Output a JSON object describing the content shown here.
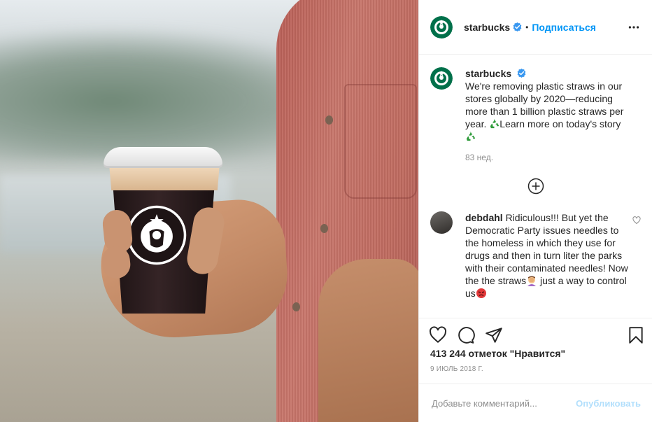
{
  "post": {
    "author": "starbucks",
    "follow_label": "Подписаться",
    "separator": "•"
  },
  "caption": {
    "username": "starbucks",
    "text_before": "We're removing plastic straws in our stores globally by 2020—reducing more than 1 billion plastic straws per year. ",
    "text_after": "Learn more on today's story",
    "time": "83 нед."
  },
  "comment": {
    "username": "debdahl",
    "text_before": "Ridiculous!!! But yet the Democratic Party issues needles to the homeless in which they use for drugs and then in turn liter the parks with their contaminated needles! Now the the straws",
    "text_after": " just a way to control us"
  },
  "likes": "413 244 отметок \"Нравится\"",
  "date": "9 ИЮЛЬ 2018 Г.",
  "add_comment": {
    "placeholder": "Добавьте комментарий...",
    "publish_label": "Опубликовать"
  },
  "icons": {
    "verified": "verified-badge-icon",
    "more": "more-options-icon",
    "load_more": "plus-circle-icon",
    "like": "heart-icon",
    "comment": "comment-bubble-icon",
    "share": "paper-plane-icon",
    "save": "bookmark-icon",
    "recycle": "recycle-emoji-icon",
    "facepalm": "facepalm-emoji-icon",
    "angry": "angry-face-emoji-icon"
  },
  "colors": {
    "starbucks_green": "#00704a",
    "link_blue": "#0095f6",
    "muted": "#8e8e8e",
    "verified": "#3897f0"
  }
}
